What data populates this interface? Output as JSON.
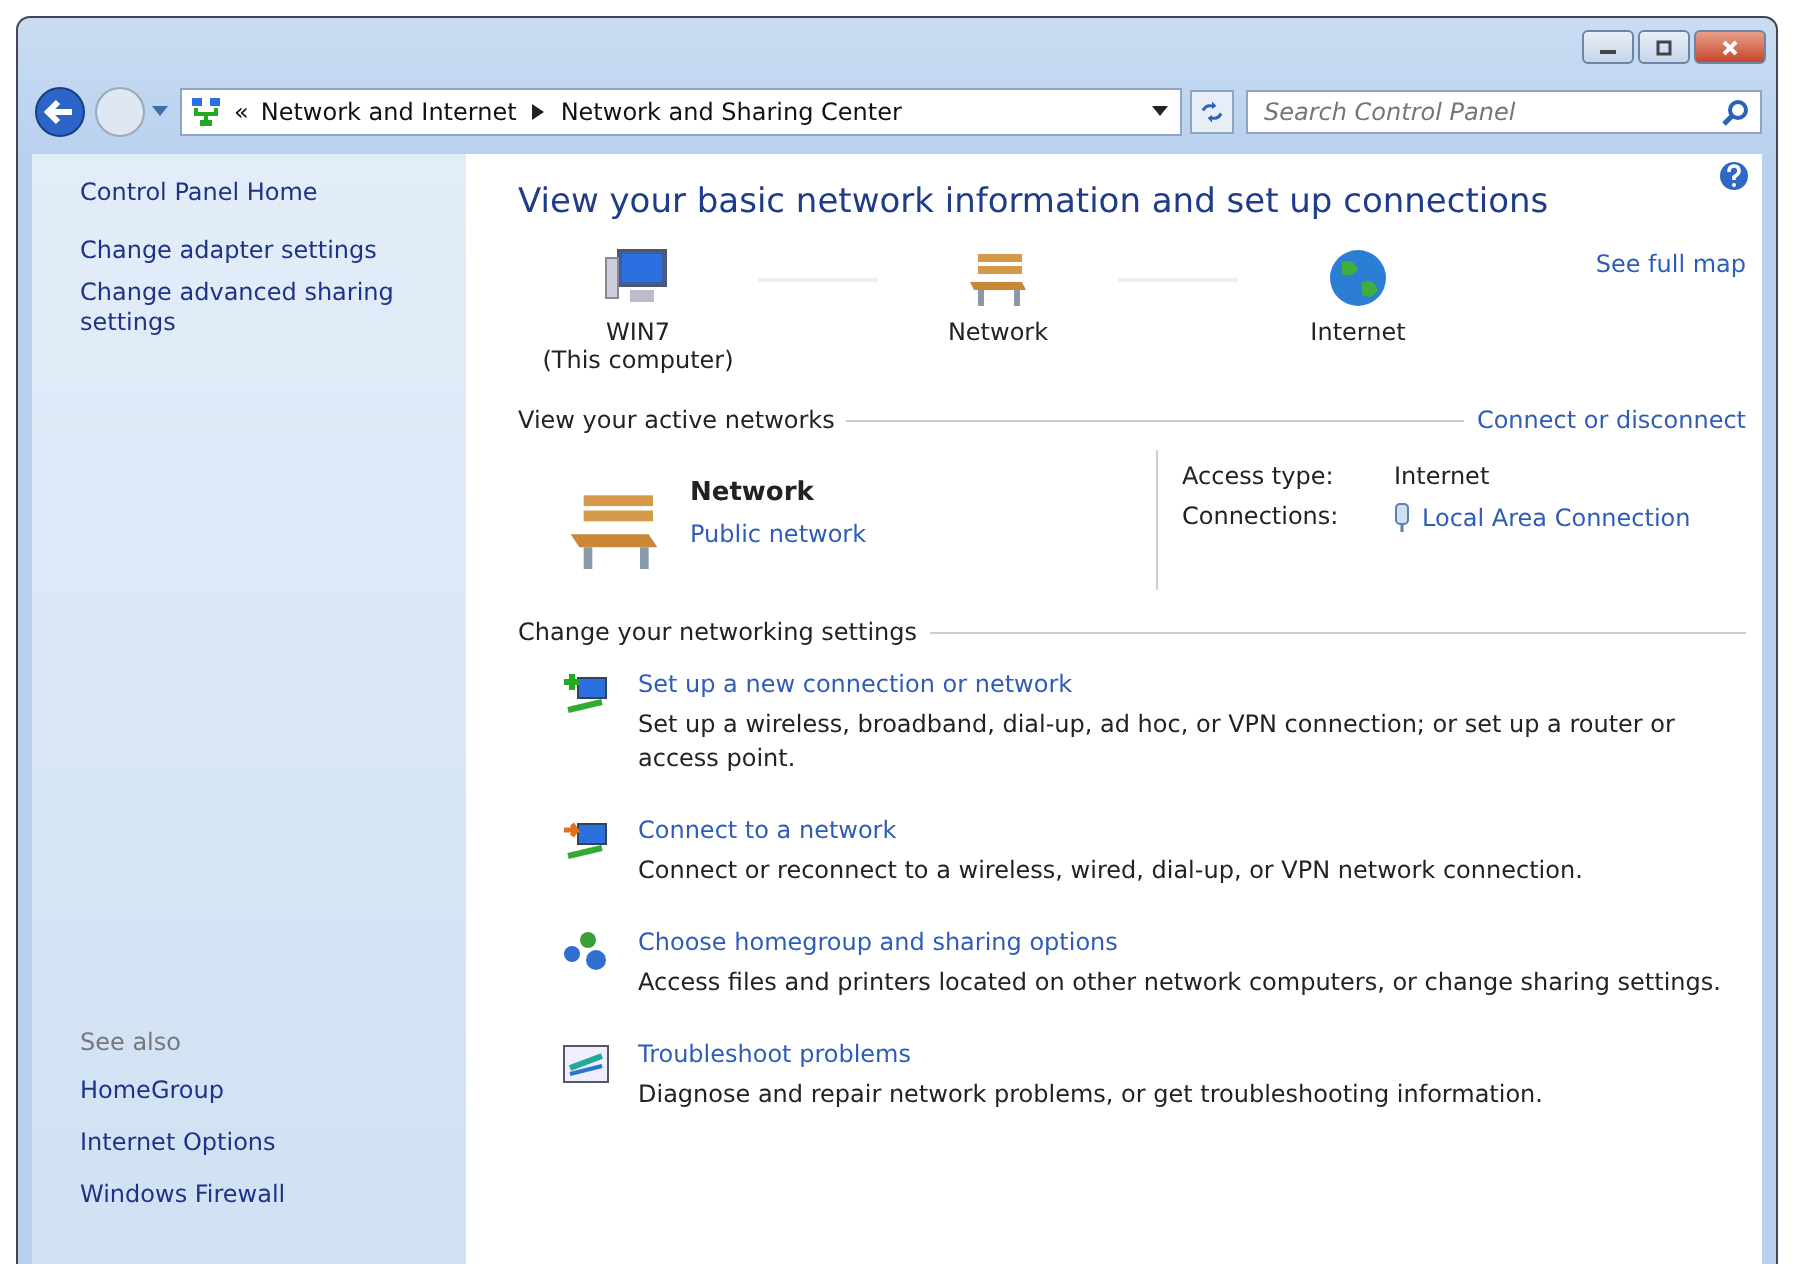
{
  "address_bar": {
    "overflow": "«",
    "breadcrumbs": [
      "Network and Internet",
      "Network and Sharing Center"
    ]
  },
  "search": {
    "placeholder": "Search Control Panel"
  },
  "sidebar": {
    "home": "Control Panel Home",
    "links": [
      "Change adapter settings",
      "Change advanced sharing settings"
    ],
    "see_also": {
      "heading": "See also",
      "links": [
        "HomeGroup",
        "Internet Options",
        "Windows Firewall"
      ]
    }
  },
  "main": {
    "title": "View your basic network information and set up connections",
    "see_full_map": "See full map",
    "map": [
      {
        "kind": "computer",
        "label": "WIN7",
        "sublabel": "(This computer)"
      },
      {
        "kind": "bench",
        "label": "Network"
      },
      {
        "kind": "globe",
        "label": "Internet"
      }
    ],
    "active_networks": {
      "heading": "View your active networks",
      "link": "Connect or disconnect",
      "name": "Network",
      "category": "Public network",
      "access_type_label": "Access type:",
      "access_type": "Internet",
      "connections_label": "Connections:",
      "connection": "Local Area Connection"
    },
    "settings": {
      "heading": "Change your networking settings",
      "tasks": [
        {
          "kind": "new",
          "title": "Set up a new connection or network",
          "description": "Set up a wireless, broadband, dial-up, ad hoc, or VPN connection; or set up a router or access point."
        },
        {
          "kind": "connect",
          "title": "Connect to a network",
          "description": "Connect or reconnect to a wireless, wired, dial-up, or VPN network connection."
        },
        {
          "kind": "homegroup",
          "title": "Choose homegroup and sharing options",
          "description": "Access files and printers located on other network computers, or change sharing settings."
        },
        {
          "kind": "troubleshoot",
          "title": "Troubleshoot problems",
          "description": "Diagnose and repair network problems, or get troubleshooting information."
        }
      ]
    }
  }
}
